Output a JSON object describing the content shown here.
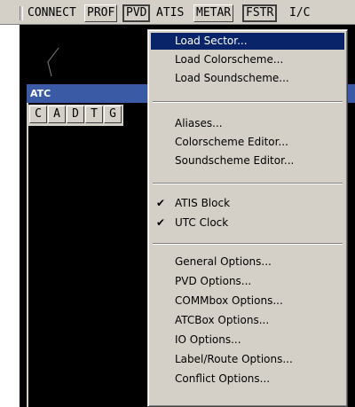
{
  "toolbar": {
    "buttons": [
      {
        "label": "CONNECT"
      },
      {
        "label": "PROF"
      },
      {
        "label": "PVD"
      },
      {
        "label": "ATIS"
      },
      {
        "label": "METAR"
      },
      {
        "label": "FSTR"
      },
      {
        "label": "I/C"
      }
    ]
  },
  "atc_window": {
    "title": "ATC",
    "columns": [
      "C",
      "A",
      "D",
      "T",
      "G"
    ]
  },
  "menu": {
    "items": [
      {
        "label": "Load Sector...",
        "selected": true
      },
      {
        "label": "Load Colorscheme..."
      },
      {
        "label": "Load Soundscheme..."
      },
      {
        "label": "Aliases..."
      },
      {
        "label": "Colorscheme Editor..."
      },
      {
        "label": "Soundscheme Editor..."
      },
      {
        "label": "ATIS Block",
        "checked": true
      },
      {
        "label": "UTC Clock",
        "checked": true
      },
      {
        "label": "General Options..."
      },
      {
        "label": "PVD Options..."
      },
      {
        "label": "COMMbox Options..."
      },
      {
        "label": "ATCBox Options..."
      },
      {
        "label": "IO Options..."
      },
      {
        "label": "Label/Route Options..."
      },
      {
        "label": "Conflict Options..."
      }
    ],
    "check_glyph": "✔"
  }
}
